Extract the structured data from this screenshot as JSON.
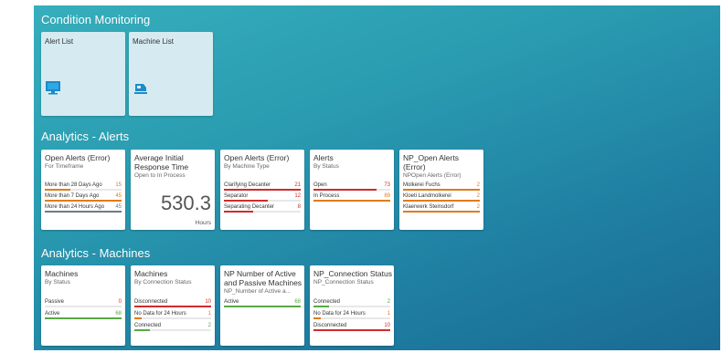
{
  "sections": {
    "condition": "Condition Monitoring",
    "alerts": "Analytics - Alerts",
    "machines": "Analytics - Machines"
  },
  "launch_tiles": [
    {
      "title": "Alert List",
      "icon": "monitor-icon"
    },
    {
      "title": "Machine List",
      "icon": "machine-icon"
    }
  ],
  "alert_tiles": {
    "open_alerts": {
      "title": "Open Alerts (Error)",
      "subtitle": "For Timeframe",
      "rows": [
        {
          "label": "More than 28 Days Ago",
          "value": "15",
          "fraction": 0.33,
          "color": "#e07b1a"
        },
        {
          "label": "More than 7 Days Ago",
          "value": "45",
          "fraction": 1.0,
          "color": "#e07b1a"
        },
        {
          "label": "More than 24 Hours Ago",
          "value": "45",
          "fraction": 1.0,
          "color": "#6b7a88"
        }
      ]
    },
    "response_time": {
      "title": "Average Initial Response Time",
      "subtitle": "Open to In Process",
      "value": "530.3",
      "unit": "Hours"
    },
    "machine_type": {
      "title": "Open Alerts (Error)",
      "subtitle": "By Machine Type",
      "rows": [
        {
          "label": "Clarifying Decanter",
          "value": "21",
          "fraction": 1.0,
          "color": "#d02b2b"
        },
        {
          "label": "Separator",
          "value": "12",
          "fraction": 0.57,
          "color": "#d02b2b"
        },
        {
          "label": "Separating Decanter",
          "value": "8",
          "fraction": 0.38,
          "color": "#d02b2b"
        }
      ]
    },
    "by_status": {
      "title": "Alerts",
      "subtitle": "By Status",
      "rows": [
        {
          "label": "Open",
          "value": "73",
          "fraction": 0.82,
          "color": "#d02b2b"
        },
        {
          "label": "In Process",
          "value": "89",
          "fraction": 1.0,
          "color": "#e07b1a"
        }
      ]
    },
    "np_open": {
      "title": "NP_Open Alerts (Error)",
      "subtitle": "NPOpen Alerts (Error)",
      "rows": [
        {
          "label": "Molkerei Fuchs",
          "value": "2",
          "fraction": 1.0,
          "color": "#e07b1a"
        },
        {
          "label": "Kloeti Landmolkerei",
          "value": "2",
          "fraction": 1.0,
          "color": "#e07b1a"
        },
        {
          "label": "Klaerwerk Steinsdorf",
          "value": "2",
          "fraction": 1.0,
          "color": "#e07b1a"
        }
      ]
    }
  },
  "machine_tiles": {
    "machines_status": {
      "title": "Machines",
      "subtitle": "By Status",
      "rows": [
        {
          "label": "Passive",
          "value": "0",
          "fraction": 0.0,
          "color": "#d02b2b"
        },
        {
          "label": "Active",
          "value": "68",
          "fraction": 1.0,
          "color": "#5aa845"
        }
      ]
    },
    "machines_connection": {
      "title": "Machines",
      "subtitle": "By Connection Status",
      "rows": [
        {
          "label": "Disconnected",
          "value": "10",
          "fraction": 1.0,
          "color": "#d02b2b"
        },
        {
          "label": "No Data for 24 Hours",
          "value": "1",
          "fraction": 0.1,
          "color": "#e07b1a"
        },
        {
          "label": "Connected",
          "value": "2",
          "fraction": 0.2,
          "color": "#5aa845"
        }
      ]
    },
    "np_active_passive": {
      "title": "NP Number of Active and Passive Machines",
      "subtitle": "NP_Number of Active a...",
      "rows": [
        {
          "label": "Active",
          "value": "68",
          "fraction": 1.0,
          "color": "#5aa845"
        }
      ]
    },
    "np_connection": {
      "title": "NP_Connection Status",
      "subtitle": "NP_Connection Status",
      "rows": [
        {
          "label": "Connected",
          "value": "2",
          "fraction": 0.2,
          "color": "#5aa845"
        },
        {
          "label": "No Data for 24 Hours",
          "value": "1",
          "fraction": 0.1,
          "color": "#e07b1a"
        },
        {
          "label": "Disconnected",
          "value": "10",
          "fraction": 1.0,
          "color": "#d02b2b"
        }
      ]
    }
  }
}
